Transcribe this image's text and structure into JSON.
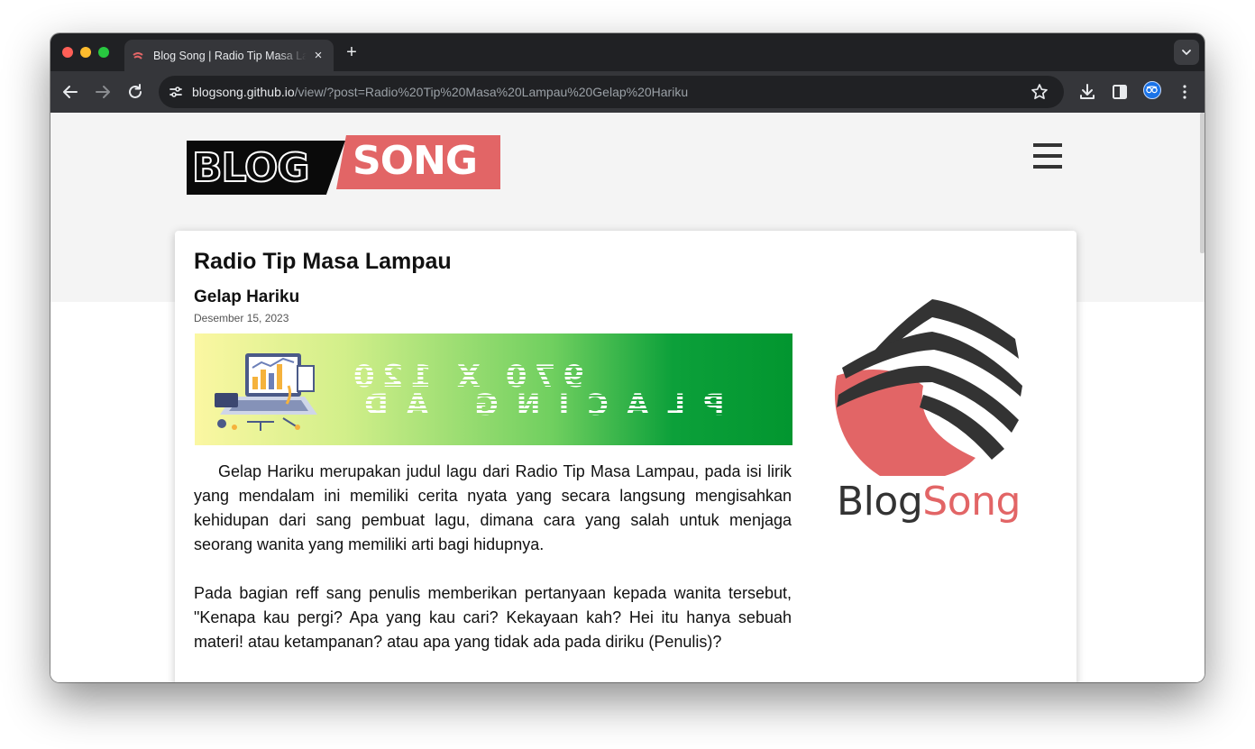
{
  "browser": {
    "tab_title": "Blog Song | Radio Tip Masa Lampau - Gelap Hariku",
    "tab_close": "×",
    "new_tab": "+",
    "url_host": "blogsong.github.io",
    "url_path": "/view/?post=Radio%20Tip%20Masa%20Lampau%20Gelap%20Hariku"
  },
  "site": {
    "logo_left": "BLOG",
    "logo_right": "SONG",
    "side_logo_dark": "Blog",
    "side_logo_accent": "Song"
  },
  "post": {
    "title": "Radio Tip Masa Lampau",
    "subtitle": "Gelap Hariku",
    "date": "Desember 15, 2023",
    "ad_line1": "970 X 120",
    "ad_line2": "PLACING AD",
    "paragraphs": [
      "Gelap Hariku merupakan judul lagu dari Radio Tip Masa Lampau, pada isi lirik yang mendalam ini memiliki cerita nyata yang secara langsung mengisahkan kehidupan dari sang pembuat lagu, dimana cara yang salah untuk menjaga seorang wanita yang memiliki arti bagi hidupnya.",
      "Pada bagian reff sang penulis memberikan pertanyaan kepada wanita tersebut, \"Kenapa kau pergi? Apa yang kau cari? Kekayaan kah? Hei itu hanya sebuah materi! atau ketampanan? atau apa yang tidak ada pada diriku (Penulis)?"
    ]
  },
  "colors": {
    "accent": "#e26566",
    "chrome_dark": "#202124",
    "chrome_toolbar": "#35363a",
    "page_band": "#f4f4f4"
  },
  "icons": [
    "back-arrow-icon",
    "forward-arrow-icon",
    "reload-icon",
    "site-info-icon",
    "bookmark-star-icon",
    "download-icon",
    "side-panel-icon",
    "profile-icon",
    "more-menu-icon",
    "hamburger-menu-icon",
    "tab-search-icon"
  ]
}
